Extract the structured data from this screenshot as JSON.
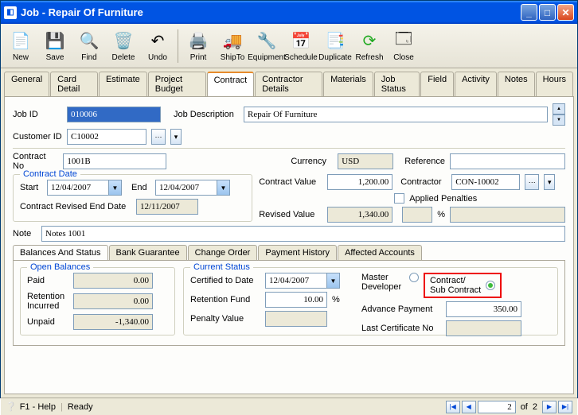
{
  "window": {
    "title": "Job - Repair Of Furniture"
  },
  "toolbar": {
    "new": "New",
    "save": "Save",
    "find": "Find",
    "delete": "Delete",
    "undo": "Undo",
    "print": "Print",
    "shipto": "ShipTo",
    "equipment": "Equipment",
    "schedule": "Schedule",
    "duplicate": "Duplicate",
    "refresh": "Refresh",
    "close": "Close"
  },
  "tabs": {
    "general": "General",
    "card_detail": "Card Detail",
    "estimate": "Estimate",
    "project_budget": "Project Budget",
    "contract": "Contract",
    "contractor_details": "Contractor Details",
    "materials": "Materials",
    "job_status": "Job Status",
    "field": "Field",
    "activity": "Activity",
    "notes": "Notes",
    "hours": "Hours"
  },
  "header": {
    "job_id_lbl": "Job ID",
    "job_id": "010006",
    "job_desc_lbl": "Job Description",
    "job_desc": "Repair Of Furniture",
    "customer_id_lbl": "Customer ID",
    "customer_id": "C10002"
  },
  "contract": {
    "no_lbl": "Contract No",
    "no": "1001B",
    "currency_lbl": "Currency",
    "currency": "USD",
    "reference_lbl": "Reference",
    "reference": "",
    "value_lbl": "Contract Value",
    "value": "1,200.00",
    "contractor_lbl": "Contractor",
    "contractor": "CON-10002",
    "revised_value_lbl": "Revised Value",
    "revised_value": "1,340.00",
    "applied_penalties_lbl": "Applied Penalties",
    "pct_lbl": "%",
    "note_lbl": "Note",
    "note": "Notes 1001"
  },
  "contract_date": {
    "legend": "Contract Date",
    "start_lbl": "Start",
    "start": "12/04/2007",
    "end_lbl": "End",
    "end": "12/04/2007",
    "revised_end_lbl": "Contract Revised End Date",
    "revised_end": "12/11/2007"
  },
  "subtabs": {
    "balances": "Balances And Status",
    "bank_guarantee": "Bank Guarantee",
    "change_order": "Change Order",
    "payment_history": "Payment History",
    "affected_accounts": "Affected Accounts"
  },
  "open_balances": {
    "legend": "Open Balances",
    "paid_lbl": "Paid",
    "paid": "0.00",
    "retention_lbl": "Retention Incurred",
    "retention": "0.00",
    "unpaid_lbl": "Unpaid",
    "unpaid": "-1,340.00"
  },
  "current_status": {
    "legend": "Current Status",
    "certified_lbl": "Certified to Date",
    "certified": "12/04/2007",
    "retention_fund_lbl": "Retention Fund",
    "retention_fund": "10.00",
    "pct": "%",
    "penalty_value_lbl": "Penalty Value",
    "penalty_value": "",
    "master_dev_lbl": "Master Developer",
    "contract_sub_lbl": "Contract/\nSub Contract",
    "advance_payment_lbl": "Advance Payment",
    "advance_payment": "350.00",
    "last_cert_lbl": "Last Certificate No",
    "last_cert": ""
  },
  "status": {
    "help": "F1 - Help",
    "ready": "Ready",
    "of": "of",
    "page": "2",
    "total": "2"
  }
}
